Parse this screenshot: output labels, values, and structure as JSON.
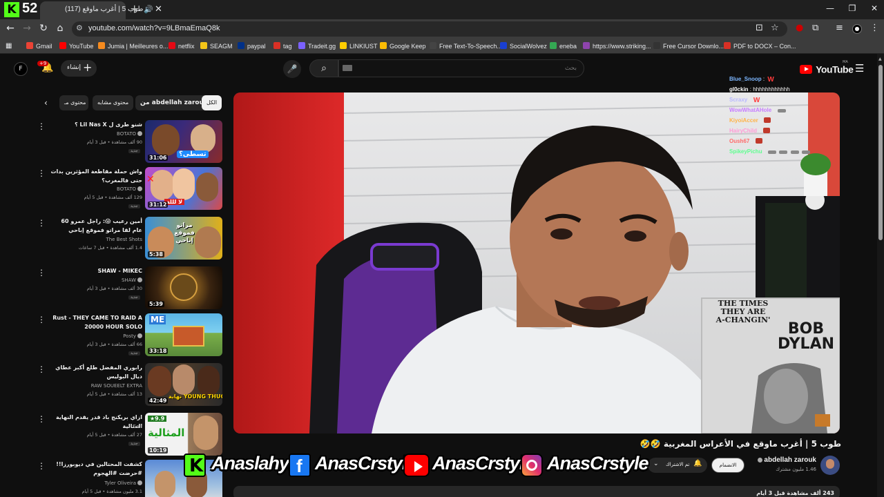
{
  "overlay_brand": {
    "letter": "K",
    "counter": "52"
  },
  "browser": {
    "tab_title": "طوب 5 | أغرب ماوقع",
    "tab_count": "(117)",
    "url": "youtube.com/watch?v=9LBmaEmaQ8k"
  },
  "bookmarks": [
    {
      "label": "Gmail",
      "color": "#ea4335"
    },
    {
      "label": "YouTube",
      "color": "#ff0000"
    },
    {
      "label": "Jumia | Meilleures o...",
      "color": "#f68b1e"
    },
    {
      "label": "netflix",
      "color": "#e50914"
    },
    {
      "label": "SEAGM",
      "color": "#f5c518"
    },
    {
      "label": "paypal",
      "color": "#003087"
    },
    {
      "label": "tag",
      "color": "#d93025"
    },
    {
      "label": "Tradeit.gg",
      "color": "#7b61ff"
    },
    {
      "label": "LINKIUST",
      "color": "#ffcc00"
    },
    {
      "label": "Google Keep",
      "color": "#fbbc04"
    },
    {
      "label": "Free Text-To-Speech...",
      "color": "#444444"
    },
    {
      "label": "SocialWolvez",
      "color": "#1a3fd1"
    },
    {
      "label": "eneba",
      "color": "#34a853"
    },
    {
      "label": "https://www.striking...",
      "color": "#8e44ad"
    },
    {
      "label": "Free Cursor Downlo...",
      "color": "#333333"
    },
    {
      "label": "PDF to DOCX – Con...",
      "color": "#d93025"
    }
  ],
  "yt_header": {
    "avatar_letter": "F",
    "notif_badge": "+9",
    "create_label": "إنشاء",
    "search_placeholder": "بحث",
    "logo_text": "YouTube",
    "logo_region": "MA"
  },
  "chips": {
    "all": "الكل",
    "from_channel": "من abdellah zarouk",
    "similar": "محتوى مشابه",
    "related": "محتوى مـ"
  },
  "related": [
    {
      "title": "شنو طرى ل Lil Nas X ؟",
      "channel": "BOTATO",
      "meta": "90 ألف مشاهدة • قبل 3 أيام",
      "duration": "31:06",
      "new": "جديد"
    },
    {
      "title": "واش حملة مقاطعة المؤثرين بدات حتى فالمغرب؟",
      "channel": "BOTATO",
      "meta": "129 ألف مشاهدة • قبل 5 أيام",
      "duration": "31:12",
      "new": "جديد"
    },
    {
      "title": "أمين رعيب 😱: راجل عمرو 60 عام لقا مراتو فموقع إباحي",
      "channel": "The Best Shots",
      "meta": "1.4 ألف مشاهدة • قبل 7 ساعات",
      "duration": "5:38",
      "new": "جديد"
    },
    {
      "title": "SHAW - MIKEC",
      "channel": "SHAW",
      "meta": "30 ألف مشاهدة • قبل 3 أيام",
      "duration": "5:39",
      "new": "جديد"
    },
    {
      "title": "Rust - THEY CAME TO RAID A 20000 HOUR SOLO",
      "channel": "Posty",
      "meta": "66 ألف مشاهدة • قبل 3 أيام",
      "duration": "33:18",
      "new": "جديد"
    },
    {
      "title": "رابوري المفضل طلع أكبر عطاي ديال البوليس",
      "channel": "RAW SOUEELT EXTRA",
      "meta": "13 ألف مشاهدة • قبل 5 أيام",
      "duration": "42:49",
      "new": "جديد"
    },
    {
      "title": "ازاي بريكنج باد قدر يقدم النهاية المثالية",
      "channel": "Saif",
      "meta": "27 ألف مشاهدة • قبل 5 أيام",
      "duration": "10:19",
      "new": "جديد"
    },
    {
      "title": "كشفت المحتالين في ديوبورزا!! #حرضت #الهجوم",
      "channel": "Tyler Oliveira",
      "meta": "3.1 مليون مشاهدة • قبل 5 أيام",
      "duration": "",
      "new": ""
    }
  ],
  "thumb_texts": {
    "t1": "تسطى؟",
    "t2": "لا لللة",
    "t3": "مراتو فموقع إباحي",
    "t5": "ME",
    "t6": "نهاية YOUNG THUG",
    "t7_rating": "★9.9",
    "t7": "المثالية"
  },
  "chat": [
    {
      "user": "Blue_Snoop",
      "color": "#7db7ff",
      "msg": "",
      "emote": "w"
    },
    {
      "user": "gl0ckin",
      "color": "#ffffff",
      "msg": "hhhhhhhhhhhh",
      "emote": ""
    },
    {
      "user": "Scraxy",
      "color": "#b8b8ff",
      "msg": "",
      "emote": "w"
    },
    {
      "user": "WowWhatAHole",
      "color": "#c77dff",
      "msg": "",
      "emote": "s"
    },
    {
      "user": "KiyoiAccer",
      "color": "#ffb347",
      "msg": "",
      "emote": "r"
    },
    {
      "user": "HairyChild",
      "color": "#ff9ad5",
      "msg": "",
      "emote": "r"
    },
    {
      "user": "Oush67",
      "color": "#ff6b6b",
      "msg": "",
      "emote": "r"
    },
    {
      "user": "SpikeyPichu",
      "color": "#5dff8f",
      "msg": "",
      "emote": "sss"
    }
  ],
  "video_overlay": {
    "poster_line1": "THE TIMES",
    "poster_line2": "THEY ARE",
    "poster_line3": "A-CHANGIN'",
    "poster_line4": "BOB",
    "poster_line5": "DYLAN"
  },
  "video": {
    "title": "طوب 5 | أغرب ماوقع في الأعراس المغربية 🤣🤣",
    "channel": "abdellah zarouk",
    "subscribers": "1.46 مليون مشترك",
    "join_label": "الانضمام",
    "subscribed_label": "تم الاشتراك",
    "description_stub": "243 ألف مشاهدة قبل 3 أيام"
  },
  "socials": [
    {
      "platform": "kick",
      "handle": "Anaslahya"
    },
    {
      "platform": "facebook",
      "handle": "AnasCrstyle"
    },
    {
      "platform": "youtube",
      "handle": "AnasCrstyle"
    },
    {
      "platform": "instagram",
      "handle": "AnasCrstyle"
    }
  ]
}
